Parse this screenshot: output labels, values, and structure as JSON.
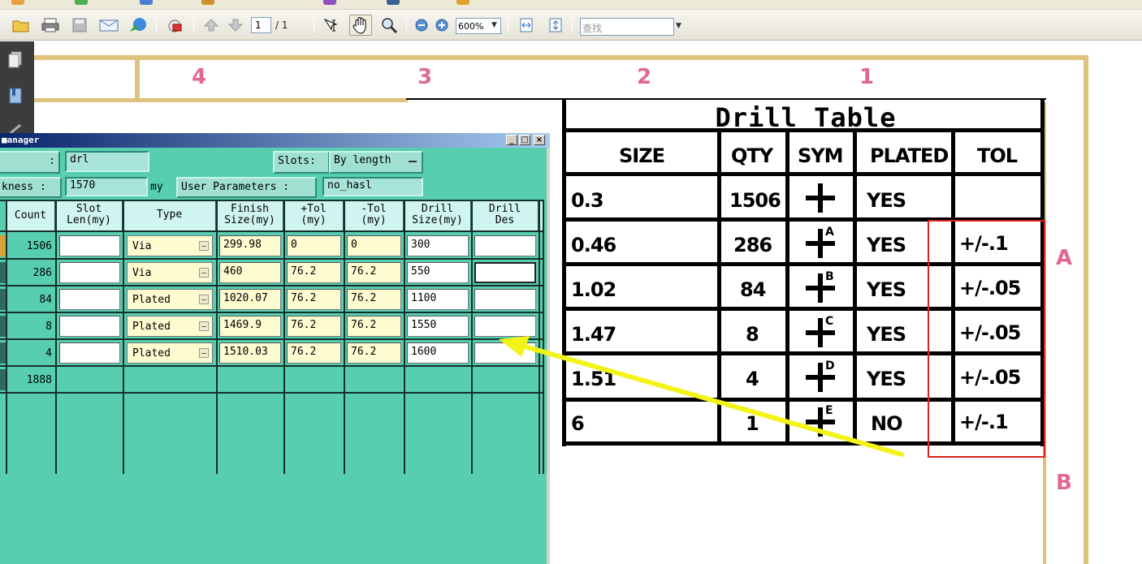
{
  "toolbar": {
    "page_current": "1",
    "page_total": "/ 1",
    "zoom": "600%",
    "search_placeholder": "查找",
    "icons": [
      "open-folder-icon",
      "print-icon",
      "save-icon",
      "email-icon",
      "web-icon",
      "security-icon",
      "previous-page-icon",
      "next-page-icon",
      "select-text-icon",
      "hand-tool-icon",
      "zoom-tool-icon",
      "zoom-out-icon",
      "zoom-in-icon",
      "fit-width-icon",
      "fit-page-icon"
    ]
  },
  "drawing": {
    "zones_top": [
      "4",
      "3",
      "2",
      "1"
    ],
    "zones_side": [
      "A",
      "B"
    ],
    "drill_table": {
      "title": "Drill Table",
      "headers": [
        "SIZE",
        "QTY",
        "SYM",
        "PLATED",
        "TOL"
      ],
      "rows": [
        {
          "size": "0.3",
          "qty": "1506",
          "sym": "",
          "plated": "YES",
          "tol": ""
        },
        {
          "size": "0.46",
          "qty": "286",
          "sym": "A",
          "plated": "YES",
          "tol": "+/-.1"
        },
        {
          "size": "1.02",
          "qty": "84",
          "sym": "B",
          "plated": "YES",
          "tol": "+/-.05"
        },
        {
          "size": "1.47",
          "qty": "8",
          "sym": "C",
          "plated": "YES",
          "tol": "+/-.05"
        },
        {
          "size": "1.51",
          "qty": "4",
          "sym": "D",
          "plated": "YES",
          "tol": "+/-.05"
        },
        {
          "size": "6",
          "qty": "1",
          "sym": "E",
          "plated": "NO",
          "tol": "+/-.1"
        }
      ]
    },
    "colors": {
      "annotation_red": "#e02020",
      "arrow_yellow": "#f3f31a",
      "zone_pink": "#e0698e",
      "frame_tan": "#dfc27b"
    }
  },
  "manager": {
    "title": "anager",
    "name_label": ":",
    "name_value": "drl",
    "slots_label": "Slots:",
    "slots_value": "By length",
    "thickness_label": "kness :",
    "thickness_value": "1570",
    "thickness_unit": "my",
    "user_params_label": "User Parameters :",
    "user_params_value": "no_hasl",
    "columns": [
      "Count",
      "Slot\nLen(my)",
      "Type",
      "Finish\nSize(my)",
      "+Tol\n(my)",
      "-Tol\n(my)",
      "Drill\nSize(my)",
      "Drill\nDes"
    ],
    "rows": [
      {
        "count": "1506",
        "slot_len": "",
        "type": "Via",
        "finish": "299.98",
        "ptol": "0",
        "ntol": "0",
        "drill": "300",
        "des": ""
      },
      {
        "count": "286",
        "slot_len": "",
        "type": "Via",
        "finish": "460",
        "ptol": "76.2",
        "ntol": "76.2",
        "drill": "550",
        "des": ""
      },
      {
        "count": "84",
        "slot_len": "",
        "type": "Plated",
        "finish": "1020.07",
        "ptol": "76.2",
        "ntol": "76.2",
        "drill": "1100",
        "des": ""
      },
      {
        "count": "8",
        "slot_len": "",
        "type": "Plated",
        "finish": "1469.9",
        "ptol": "76.2",
        "ntol": "76.2",
        "drill": "1550",
        "des": ""
      },
      {
        "count": "4",
        "slot_len": "",
        "type": "Plated",
        "finish": "1510.03",
        "ptol": "76.2",
        "ntol": "76.2",
        "drill": "1600",
        "des": ""
      }
    ],
    "total_count": "1888"
  }
}
